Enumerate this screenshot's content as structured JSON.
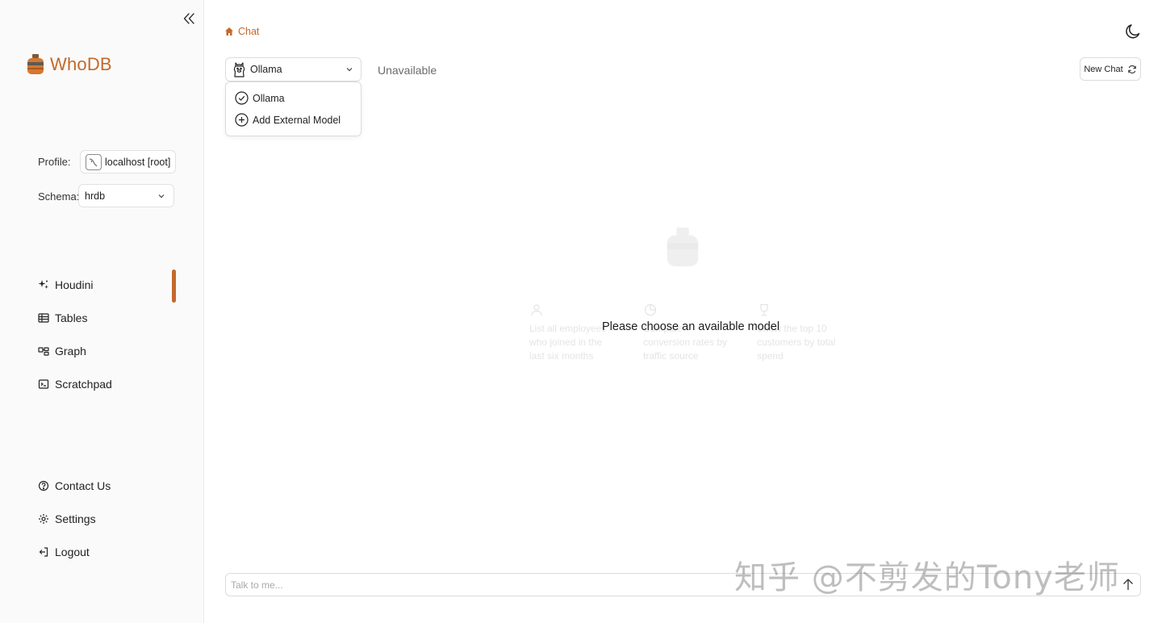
{
  "app": {
    "brand": "WhoDB",
    "accent": "#c4692b"
  },
  "sidebar": {
    "profile_label": "Profile:",
    "profile_value": "localhost [root]",
    "schema_label": "Schema:",
    "schema_value": "hrdb",
    "nav": [
      {
        "label": "Houdini",
        "icon": "sparkles-icon",
        "active": true
      },
      {
        "label": "Tables",
        "icon": "table-icon"
      },
      {
        "label": "Graph",
        "icon": "graph-icon"
      },
      {
        "label": "Scratchpad",
        "icon": "scratchpad-icon"
      }
    ],
    "footer": [
      {
        "label": "Contact Us",
        "icon": "help-circle-icon"
      },
      {
        "label": "Settings",
        "icon": "gear-icon"
      },
      {
        "label": "Logout",
        "icon": "logout-icon"
      }
    ]
  },
  "header": {
    "breadcrumb": "Chat"
  },
  "chat": {
    "model_selected": "Ollama",
    "model_status": "Unavailable",
    "new_chat_label": "New Chat",
    "dropdown": [
      {
        "label": "Ollama",
        "icon": "check-circle-icon"
      },
      {
        "label": "Add External Model",
        "icon": "plus-circle-icon"
      }
    ],
    "empty_message": "Please choose an available model",
    "suggestions": [
      "List all employees who joined in the last six months",
      "Compare conversion rates by traffic source",
      "Show the top 10 customers by total spend"
    ],
    "input_placeholder": "Talk to me..."
  },
  "watermark": "知乎 @不剪发的Tony老师"
}
